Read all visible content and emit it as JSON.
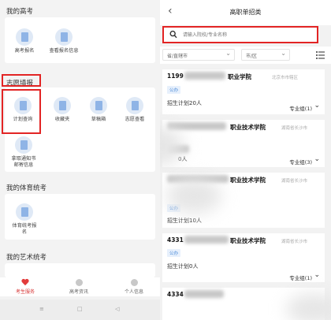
{
  "left": {
    "sections": {
      "gaokao": "我的高考",
      "zhiyuan": "志愿填报",
      "tiyu": "我的体育统考",
      "yishu": "我的艺术统考"
    },
    "gaokao_items": [
      "高考报名",
      "查看报名信息"
    ],
    "zhiyuan_items": [
      "计划查询",
      "收藏夹",
      "草稿箱",
      "志愿查看"
    ],
    "zhiyuan_extra": [
      "拿取通知书",
      "邮寄信息"
    ],
    "tiyu_items": [
      "体育统考报",
      "名"
    ],
    "tabs": [
      {
        "label": "考生服务",
        "icon": "heart-icon",
        "active": true
      },
      {
        "label": "高考资讯",
        "icon": "news-icon",
        "active": false
      },
      {
        "label": "个人信息",
        "icon": "profile-icon",
        "active": false
      }
    ],
    "accent": "#e22424"
  },
  "right": {
    "title": "高职单招类",
    "search_placeholder": "请输入院校/专业名称",
    "filter_province": "省/直辖市",
    "filter_city": "市/区",
    "results": [
      {
        "code": "1199",
        "name_suffix": "职业学院",
        "location": "北京市市辖区",
        "badge": "公办",
        "plan": "招生计划20人",
        "groups": "专业组(1)"
      },
      {
        "code": "",
        "name_suffix": "职业技术学院",
        "location": "湖南省长沙市",
        "badge": "",
        "plan": "0人",
        "groups": "专业组(3)"
      },
      {
        "code": "",
        "name_suffix": "职业技术学院",
        "location": "湖南省长沙市",
        "badge": "公办",
        "plan": "招生计划10人",
        "groups": "专业组(1)"
      },
      {
        "code": "4331",
        "name_suffix": "职业技术学院",
        "location": "湖南省长沙市",
        "badge": "公办",
        "plan": "招生计划0人",
        "groups": "专业组(1)"
      },
      {
        "code": "4334",
        "name_suffix": "",
        "location": "",
        "badge": "",
        "plan": "",
        "groups": ""
      }
    ]
  }
}
